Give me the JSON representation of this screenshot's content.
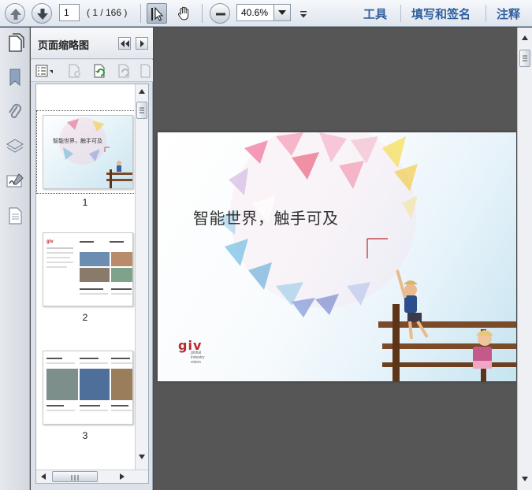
{
  "toolbar": {
    "current_page": "1",
    "page_count_label": "( 1 / 166 )",
    "zoom": "40.6%",
    "menus": [
      "工具",
      "填写和签名",
      "注释"
    ]
  },
  "panel": {
    "title": "页面缩略图",
    "thumbnails": [
      {
        "number": "1",
        "title": "智能世界，触手可及",
        "selected": true
      },
      {
        "number": "2",
        "title": "",
        "selected": false
      },
      {
        "number": "3",
        "title": "",
        "selected": false
      }
    ]
  },
  "document": {
    "headline": "智能世界，触手可及",
    "logo": "giv",
    "logo_sub": "global industry vision"
  },
  "icons": {
    "prev_page": "arrow-up-icon",
    "next_page": "arrow-down-icon",
    "select_tool": "cursor-arrow-icon",
    "hand_tool": "hand-icon",
    "zoom_out": "minus-icon"
  }
}
